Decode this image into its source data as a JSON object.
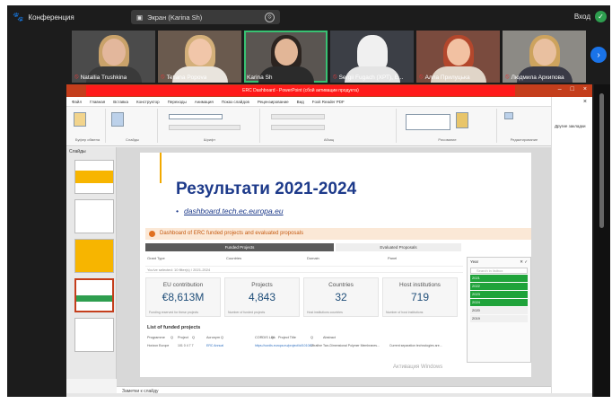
{
  "topbar": {
    "app_title": "Конференция",
    "share_label": "Экран (Karina Sh)",
    "exit_label": "Вход"
  },
  "participants": [
    {
      "name": "Natallia Trushkina",
      "muted": true,
      "bg": "#4b4b4b",
      "hair": "#c9a26a",
      "skin": "#e3b79c",
      "cloth": "#3a3a3a"
    },
    {
      "name": "Tetiana Popova",
      "muted": true,
      "bg": "#6a5a4e",
      "hair": "#d4b07a",
      "skin": "#f1c6a9",
      "cloth": "#e9e4dd"
    },
    {
      "name": "Karina Sh",
      "muted": false,
      "bg": "#5a5551",
      "hair": "#2c2420",
      "skin": "#e2b697",
      "cloth": "#2b2b2b"
    },
    {
      "name": "Sergii Fugach (ХРТ), E...",
      "muted": true,
      "bg": "#3c3f46",
      "hair": "#f0f0f0",
      "skin": "#f0f0f0",
      "cloth": "#e4e4e4"
    },
    {
      "name": "Алла Прилуцька",
      "muted": true,
      "bg": "#7a4b3e",
      "hair": "#b3472c",
      "skin": "#f2c1a2",
      "cloth": "#e0d5c8"
    },
    {
      "name": "Людмила Архипова",
      "muted": true,
      "bg": "#8c8a85",
      "hair": "#cda35e",
      "skin": "#e9c0a0",
      "cloth": "#3a3a46"
    }
  ],
  "powerpoint": {
    "title_text": "ERC Dashboard - PowerPoint (сбой активации продукта)",
    "menu": [
      "Файл",
      "Главная",
      "Вставка",
      "Конструктор",
      "Переходы",
      "Анимация",
      "Показ слайдов",
      "Рецензирование",
      "Вид",
      "Foxit Reader PDF"
    ],
    "ribbon_groups": [
      "Буфер обмена",
      "Слайды",
      "Шрифт",
      "Абзац",
      "Рисование",
      "Редактирование"
    ],
    "right_pane_title": "Другие закладки",
    "thumbs_label": "Слайды",
    "notes_placeholder": "Заметки к слайду",
    "watermark": "Активация Windows",
    "watermark_sub": "Чтобы активировать Windows, перейдите в раздел «Параметры»."
  },
  "slide": {
    "heading": "Результати 2021-2024",
    "link": "dashboard.tech.ec.europa.eu",
    "dashboard_title": "Dashboard of ERC funded projects and evaluated proposals",
    "tabs": [
      "Funded Projects",
      "Evaluated Proposals"
    ],
    "filter_labels": [
      "Grant Type",
      "Countries",
      "Domain",
      "Panel"
    ],
    "filter_hint": "You've selected: 10 filter(s) / 2021-2024",
    "kpis": [
      {
        "title": "EU contribution",
        "value": "€8,613M",
        "sub": "Funding reserved for these projects"
      },
      {
        "title": "Projects",
        "value": "4,843",
        "sub": "Number of funded projects"
      },
      {
        "title": "Countries",
        "value": "32",
        "sub": "Host institutions countries"
      },
      {
        "title": "Host institutions",
        "value": "719",
        "sub": "Number of host institutions"
      }
    ],
    "list_title": "List of funded projects",
    "list_columns": [
      "Programme",
      "Q",
      "Project",
      "Q",
      "Acronym",
      "Q",
      "CORDIS Link",
      "Q",
      "Project Title",
      "Q",
      "Abstract"
    ],
    "list_row": [
      "Horizon Europe",
      "101 0 4 7 7",
      "ERC Annual",
      "https://cordis.europa.eu/project/id/101047",
      "Ultrafine Two-Dimensional Polymer Membranes...",
      "Current separation technologies are..."
    ],
    "year_panel": {
      "title": "Year",
      "search_placeholder": "Search in listbox",
      "years": [
        "2021",
        "2022",
        "2023",
        "2024",
        "2020",
        "2019"
      ],
      "selected": [
        true,
        true,
        true,
        true,
        false,
        false
      ]
    }
  }
}
